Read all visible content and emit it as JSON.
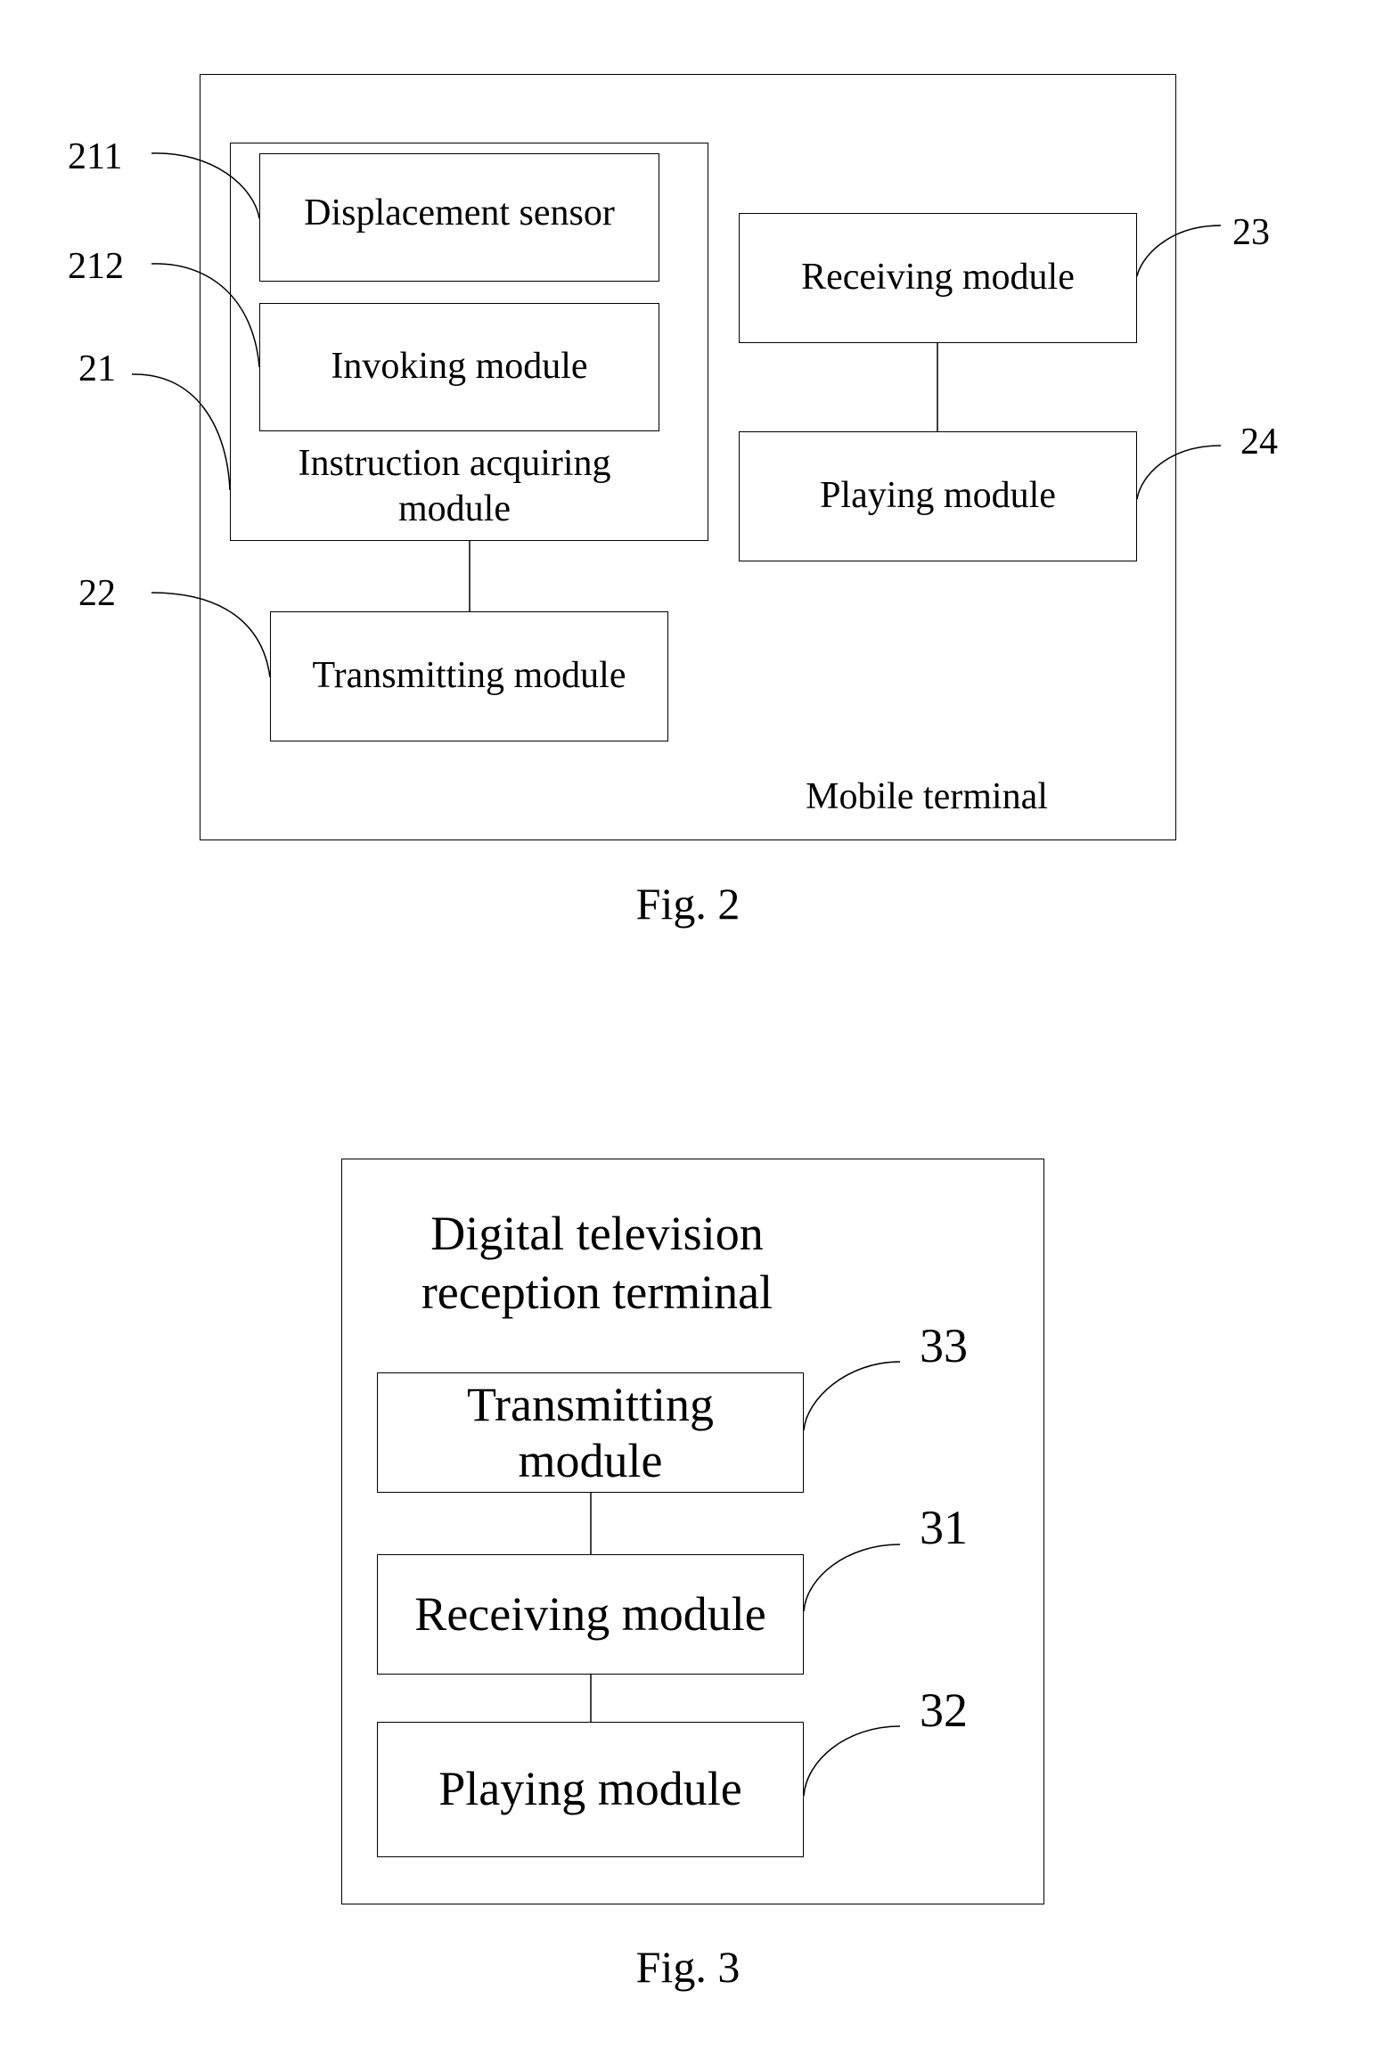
{
  "figure2": {
    "caption": "Fig. 2",
    "container_label": "Mobile terminal",
    "instruction_module": {
      "label": "Instruction acquiring module",
      "ref": "21"
    },
    "displacement_sensor": {
      "label": "Displacement sensor",
      "ref": "211"
    },
    "invoking_module": {
      "label": "Invoking module",
      "ref": "212"
    },
    "transmitting_module": {
      "label": "Transmitting module",
      "ref": "22"
    },
    "receiving_module": {
      "label": "Receiving module",
      "ref": "23"
    },
    "playing_module": {
      "label": "Playing module",
      "ref": "24"
    }
  },
  "figure3": {
    "caption": "Fig. 3",
    "container_label": "Digital television reception terminal",
    "transmitting_module": {
      "label": "Transmitting module",
      "ref": "33"
    },
    "receiving_module": {
      "label": "Receiving module",
      "ref": "31"
    },
    "playing_module": {
      "label": "Playing module",
      "ref": "32"
    }
  }
}
